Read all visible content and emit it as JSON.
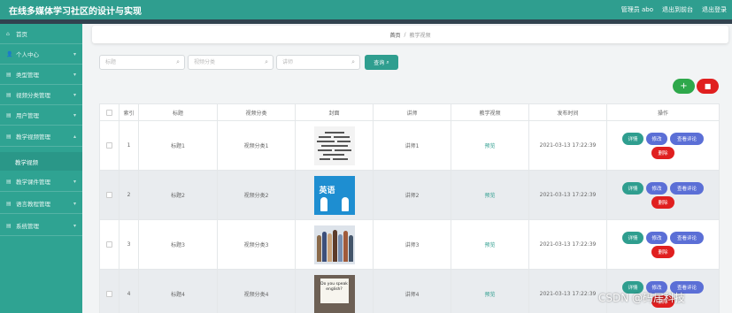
{
  "header": {
    "title": "在线多媒体学习社区的设计与实现",
    "admin_label": "管理员 abo",
    "exit_backend": "退出到前台",
    "logout": "退出登录"
  },
  "sidebar": {
    "items": [
      {
        "label": "首页",
        "icon": "home-icon"
      },
      {
        "label": "个人中心",
        "icon": "user-icon"
      },
      {
        "label": "类型管理",
        "icon": "list-icon"
      },
      {
        "label": "视频分类管理",
        "icon": "list-icon"
      },
      {
        "label": "用户管理",
        "icon": "list-icon"
      },
      {
        "label": "教学视频管理",
        "icon": "list-icon"
      },
      {
        "label": "教学视频",
        "sub": true
      },
      {
        "label": "教学课件管理",
        "icon": "list-icon"
      },
      {
        "label": "语言教程管理",
        "icon": "list-icon"
      },
      {
        "label": "系统管理",
        "icon": "list-icon"
      }
    ]
  },
  "breadcrumb": {
    "home": "首页",
    "separator": "/",
    "current": "教学视频"
  },
  "search": {
    "title_placeholder": "标题",
    "category_placeholder": "视频分类",
    "teacher_placeholder": "讲师",
    "query_label": "查询"
  },
  "actions": {
    "add": "+",
    "delete": "🗑"
  },
  "table": {
    "headers": [
      "索引",
      "标题",
      "视频分类",
      "封面",
      "讲师",
      "教学视频",
      "发布时间",
      "操作"
    ],
    "rows": [
      {
        "index": "1",
        "title": "标题1",
        "category": "视频分类1",
        "teacher": "讲师1",
        "video": "预览",
        "time": "2021-03-13 17:22:39",
        "cover": "word-cloud"
      },
      {
        "index": "2",
        "title": "标题2",
        "category": "视频分类2",
        "teacher": "讲师2",
        "video": "预览",
        "time": "2021-03-13 17:22:39",
        "cover": "english-sign"
      },
      {
        "index": "3",
        "title": "标题3",
        "category": "视频分类3",
        "teacher": "讲师3",
        "video": "预览",
        "time": "2021-03-13 17:22:39",
        "cover": "people-group"
      },
      {
        "index": "4",
        "title": "标题4",
        "category": "视频分类4",
        "teacher": "讲师4",
        "video": "预览",
        "time": "2021-03-13 17:22:39",
        "cover": "do-you-speak-english"
      }
    ],
    "ops": {
      "detail": "详情",
      "edit": "修改",
      "comments": "查看评论",
      "delete": "删除"
    }
  },
  "covers": {
    "english_sign_text": "英语",
    "do_you_speak_text": "Do you speak english?"
  },
  "watermark": "CSDN @码居科技",
  "colors": {
    "primary": "#2f9e8f",
    "accent": "#5b6fd6",
    "danger": "#e01f1f",
    "success": "#2ea84b"
  }
}
